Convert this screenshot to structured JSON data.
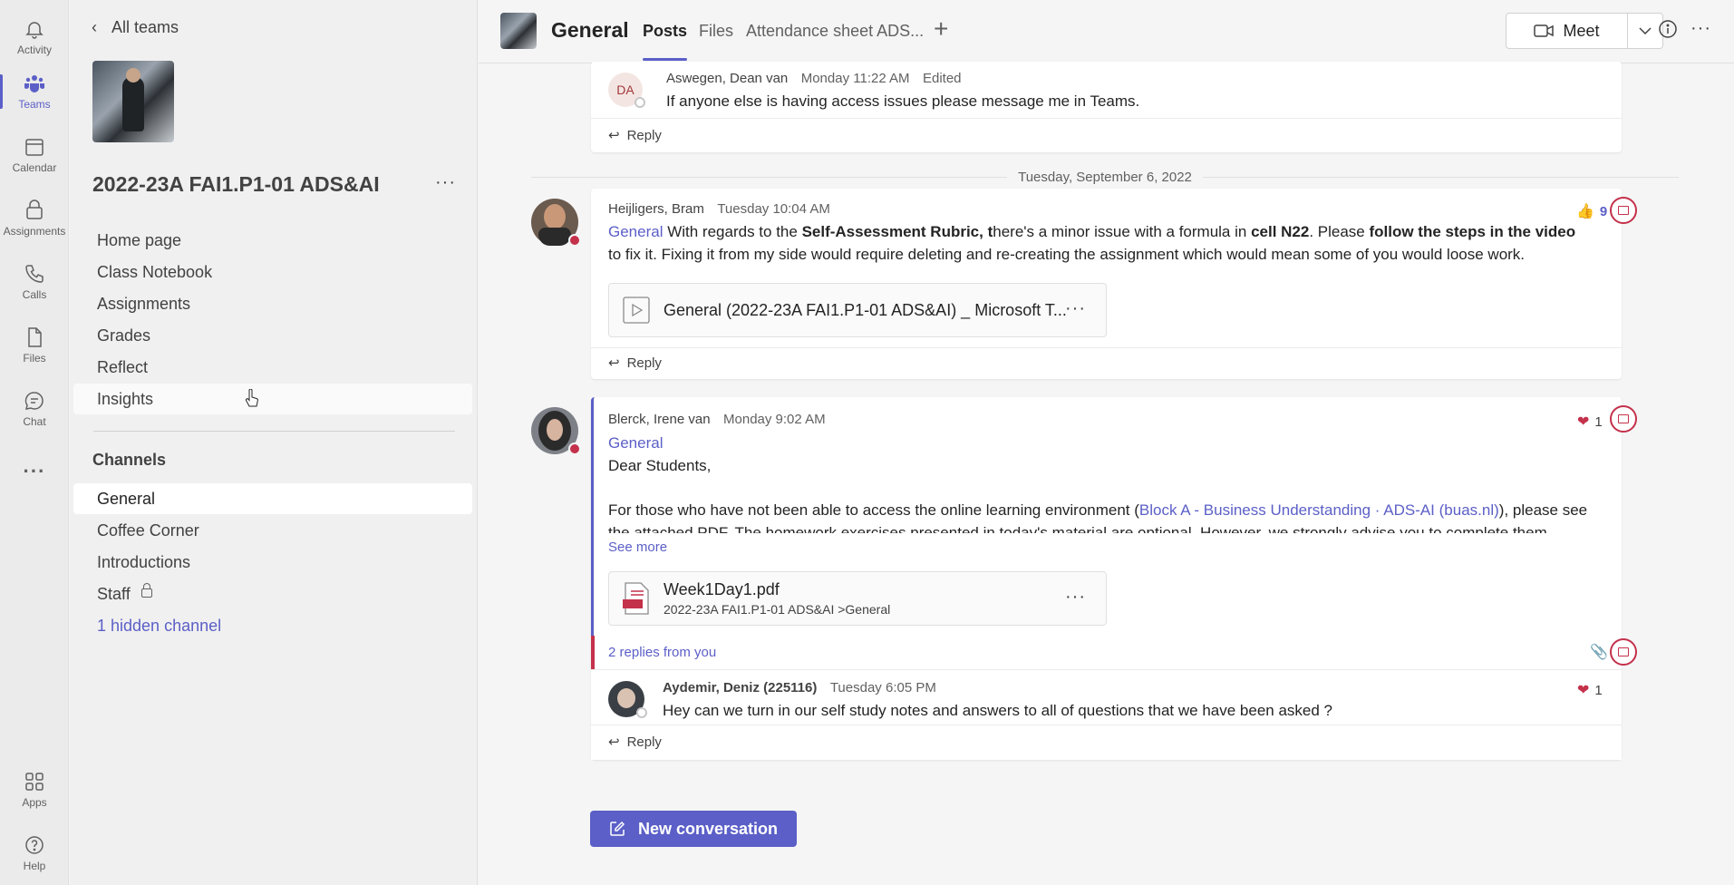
{
  "rail": {
    "items": [
      {
        "label": "Activity",
        "icon": "bell-icon"
      },
      {
        "label": "Teams",
        "icon": "teams-icon"
      },
      {
        "label": "Calendar",
        "icon": "calendar-icon"
      },
      {
        "label": "Assignments",
        "icon": "assignments-icon"
      },
      {
        "label": "Calls",
        "icon": "phone-icon"
      },
      {
        "label": "Files",
        "icon": "file-icon"
      },
      {
        "label": "Chat",
        "icon": "chat-icon"
      },
      {
        "label": "Apps",
        "icon": "apps-icon"
      },
      {
        "label": "Help",
        "icon": "help-icon"
      }
    ],
    "more": "···",
    "active": "Teams"
  },
  "sidebar": {
    "back_label": "All teams",
    "team_name": "2022-23A FAI1.P1-01 ADS&AI",
    "more": "···",
    "nav": [
      "Home page",
      "Class Notebook",
      "Assignments",
      "Grades",
      "Reflect",
      "Insights"
    ],
    "channels_heading": "Channels",
    "channels": [
      "General",
      "Coffee Corner",
      "Introductions",
      "Staff"
    ],
    "hidden_channels": "1 hidden channel"
  },
  "header": {
    "channel_title": "General",
    "tabs": [
      "Posts",
      "Files",
      "Attendance sheet ADS..."
    ],
    "add_tab": "+",
    "meet_label": "Meet",
    "more": "···"
  },
  "posts": {
    "post1": {
      "initials": "DA",
      "author": "Aswegen, Dean van",
      "time": "Monday 11:22 AM",
      "edited": "Edited",
      "text": "If anyone else is having access issues please message me in Teams.",
      "reply": "Reply"
    },
    "date_separator": "Tuesday, September 6, 2022",
    "post2": {
      "author": "Heijligers, Bram",
      "time": "Tuesday 10:04 AM",
      "channel_tag": "General",
      "t1": " With regards to the ",
      "b1": "Self-Assessment Rubric, t",
      "t2": "here's a minor issue with a formula in ",
      "b2": "cell N22",
      "t3": ". Please ",
      "b3": "follow the steps in the video",
      "t4": "to fix it. Fixing it from my side would require deleting and re-creating the assignment which would mean some of you would loose work.",
      "attachment": "General (2022-23A FAI1.P1-01 ADS&AI) _ Microsoft T...",
      "reaction_count": "9",
      "reply": "Reply"
    },
    "post3": {
      "author": "Blerck, Irene van",
      "time": "Monday 9:02 AM",
      "channel_tag": "General",
      "greeting": "Dear Students,",
      "body_pre": "For those who have not been able to access the online learning environment (",
      "body_link": "Block A - Business Understanding · ADS-AI (buas.nl)",
      "body_post": "), please see",
      "body_cut": "the attached PDF. The homework exercises presented in today's material are optional. However, we strongly advise you to complete them",
      "see_more": "See more",
      "file_name": "Week1Day1.pdf",
      "file_path": "2022-23A FAI1.P1-01 ADS&AI >General",
      "reaction_count": "1",
      "replies_label": "2 replies from you",
      "reply_author": "Aydemir, Deniz (225116)",
      "reply_time": "Tuesday 6:05 PM",
      "reply_text": "Hey can we turn in our self study notes and answers to all of questions that we have been asked ?",
      "reply_reaction_count": "1",
      "reply": "Reply"
    }
  },
  "new_conversation": "New conversation",
  "colors": {
    "accent": "#5b5fc7",
    "flag": "#c4314b"
  }
}
